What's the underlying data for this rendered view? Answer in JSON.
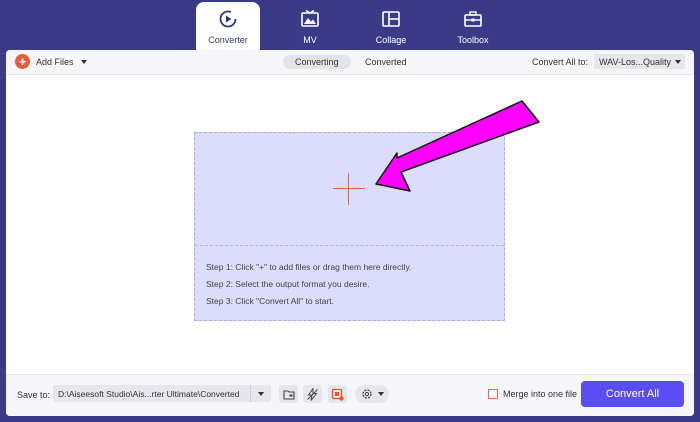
{
  "nav": {
    "tabs": [
      {
        "label": "Converter",
        "icon": "converter-icon"
      },
      {
        "label": "MV",
        "icon": "mv-icon"
      },
      {
        "label": "Collage",
        "icon": "collage-icon"
      },
      {
        "label": "Toolbox",
        "icon": "toolbox-icon"
      }
    ],
    "active": "Converter"
  },
  "toolbar": {
    "add_files_label": "Add Files",
    "tabs": [
      "Converting",
      "Converted"
    ],
    "active_tab": "Converting",
    "convert_all_to_label": "Convert All to:",
    "format_value": "WAV-Los...Quality"
  },
  "dropzone": {
    "steps": [
      "Step 1: Click \"+\" to add files or drag them here directly.",
      "Step 2: Select the output format you desire.",
      "Step 3: Click \"Convert All\" to start."
    ]
  },
  "bottom": {
    "save_to_label": "Save to:",
    "save_path": "D:\\Aiseesoft Studio\\Ais...rter Ultimate\\Converted",
    "merge_label": "Merge into one file",
    "merge_checked": false,
    "convert_all_label": "Convert All"
  },
  "colors": {
    "frame": "#3a3a86",
    "accent": "#5a4ef2",
    "add_icon": "#f05a3a",
    "dropzone": "#dcdcfb",
    "annotation_arrow": "#ff00ff"
  }
}
